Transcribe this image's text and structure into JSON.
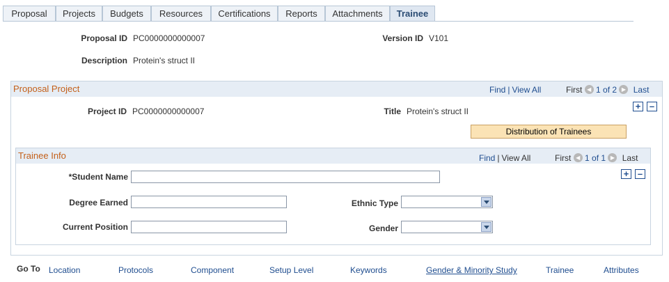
{
  "tabs": [
    {
      "label": "Proposal",
      "active": false
    },
    {
      "label": "Projects",
      "active": false
    },
    {
      "label": "Budgets",
      "active": false
    },
    {
      "label": "Resources",
      "active": false
    },
    {
      "label": "Certifications",
      "active": false
    },
    {
      "label": "Reports",
      "active": false
    },
    {
      "label": "Attachments",
      "active": false
    },
    {
      "label": "Trainee",
      "active": true
    }
  ],
  "header": {
    "proposal_id_label": "Proposal ID",
    "proposal_id": "PC0000000000007",
    "version_id_label": "Version ID",
    "version_id": "V101",
    "description_label": "Description",
    "description": "Protein's struct II"
  },
  "proposal_project": {
    "title": "Proposal Project",
    "find": "Find",
    "view_all": "View All",
    "first": "First",
    "counter": "1 of 2",
    "last": "Last",
    "project_id_label": "Project ID",
    "project_id": "PC0000000000007",
    "title_label": "Title",
    "title_value": "Protein's struct II",
    "distribution_button": "Distribution of Trainees"
  },
  "trainee_info": {
    "title": "Trainee Info",
    "find": "Find",
    "view_all": "View All",
    "first": "First",
    "counter": "1 of 1",
    "last": "Last",
    "student_name_label": "*Student Name",
    "student_name_value": "",
    "degree_earned_label": "Degree Earned",
    "degree_earned_value": "",
    "current_position_label": "Current Position",
    "current_position_value": "",
    "ethnic_type_label": "Ethnic Type",
    "ethnic_type_value": "",
    "gender_label": "Gender",
    "gender_value": ""
  },
  "goto": {
    "label": "Go To",
    "links": [
      "Location",
      "Protocols",
      "Component",
      "Setup Level",
      "Keywords",
      "Gender & Minority Study",
      "Trainee",
      "Attributes"
    ]
  },
  "colors": {
    "group_title": "#c4601a",
    "link": "#1f4d8f",
    "button_bg": "#fbe3b5"
  }
}
